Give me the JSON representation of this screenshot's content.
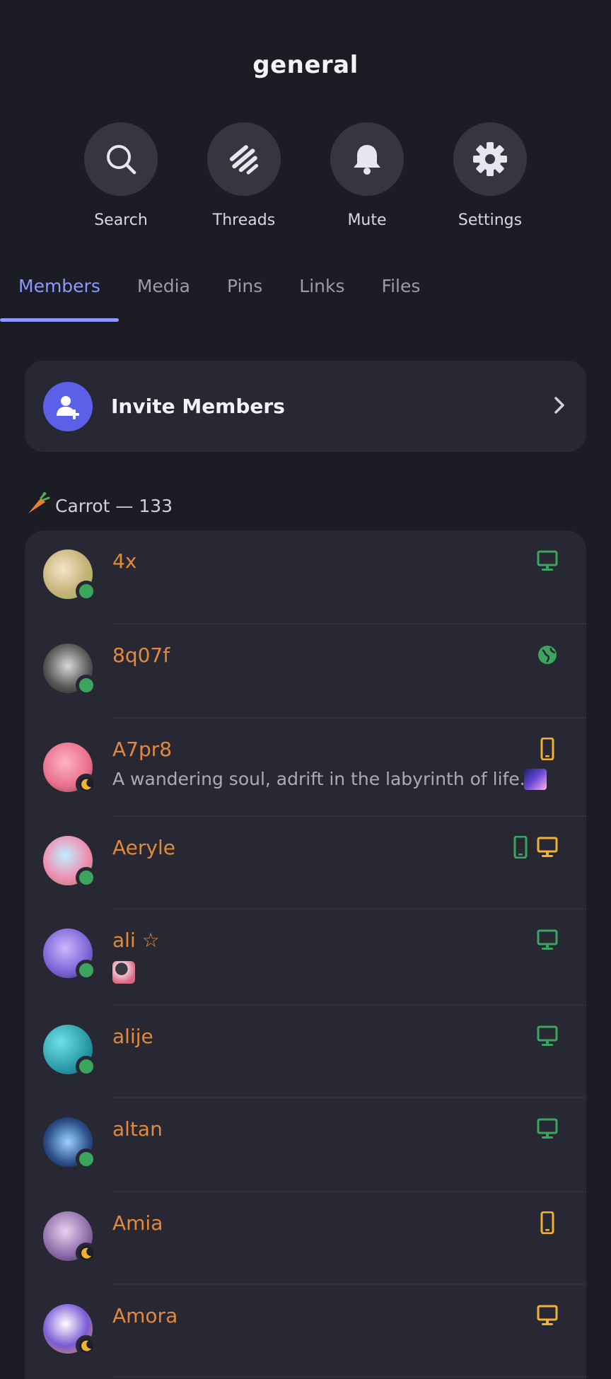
{
  "channel": {
    "title": "general"
  },
  "actions": [
    {
      "label": "Search",
      "icon": "search-icon"
    },
    {
      "label": "Threads",
      "icon": "threads-icon"
    },
    {
      "label": "Mute",
      "icon": "bell-icon"
    },
    {
      "label": "Settings",
      "icon": "gear-icon"
    }
  ],
  "tabs": [
    "Members",
    "Media",
    "Pins",
    "Links",
    "Files"
  ],
  "active_tab": "Members",
  "invite": {
    "label": "Invite Members",
    "icon": "add-user-icon"
  },
  "section": {
    "emoji": "carrot-emoji",
    "label": "Carrot — 133"
  },
  "colors": {
    "accent": "#8f98ff",
    "invite": "#5a60e8",
    "name": "#e4883a",
    "online": "#3ba55d",
    "idle": "#f0b232"
  },
  "members": [
    {
      "name": "4x",
      "subtitle": "",
      "status": "online",
      "devices": [
        {
          "type": "desktop",
          "color": "#3ba55d"
        }
      ]
    },
    {
      "name": "8q07f",
      "subtitle": "",
      "status": "online",
      "devices": [
        {
          "type": "web",
          "color": "#3ba55d"
        }
      ]
    },
    {
      "name": "A7pr8",
      "subtitle": "A wandering soul, adrift in the labyrinth of life.",
      "status": "idle",
      "devices": [
        {
          "type": "mobile",
          "color": "#f0b232"
        }
      ]
    },
    {
      "name": "Aeryle",
      "subtitle": "",
      "status": "online",
      "devices": [
        {
          "type": "mobile",
          "color": "#3ba55d"
        },
        {
          "type": "desktop",
          "color": "#f0b232"
        }
      ]
    },
    {
      "name": "ali ☆",
      "subtitle": "",
      "status": "online",
      "devices": [
        {
          "type": "desktop",
          "color": "#3ba55d"
        }
      ]
    },
    {
      "name": "alije",
      "subtitle": "",
      "status": "online",
      "devices": [
        {
          "type": "desktop",
          "color": "#3ba55d"
        }
      ]
    },
    {
      "name": "altan",
      "subtitle": "",
      "status": "online",
      "devices": [
        {
          "type": "desktop",
          "color": "#3ba55d"
        }
      ]
    },
    {
      "name": "Amia",
      "subtitle": "",
      "status": "idle",
      "devices": [
        {
          "type": "mobile",
          "color": "#f0b232"
        }
      ]
    },
    {
      "name": "Amora",
      "subtitle": "",
      "status": "idle",
      "devices": [
        {
          "type": "desktop",
          "color": "#f0b232"
        }
      ]
    }
  ]
}
